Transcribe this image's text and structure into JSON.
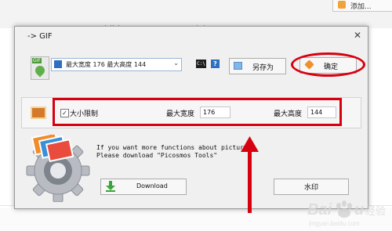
{
  "background": {
    "header_button_label": "添加...",
    "column1": "文件名",
    "column2": "大小"
  },
  "dialog": {
    "title": "-> GIF",
    "close_glyph": "✕",
    "preset_value": "最大宽度 176 最大高度 144",
    "preset_arrow": "⌄",
    "cmd_label": "C:\\",
    "help_label": "?",
    "save_as_label": "另存为",
    "ok_label": "确定",
    "size_limit_label": "大小限制",
    "size_limit_checked": true,
    "max_width_label": "最大宽度",
    "max_width_value": "176",
    "max_height_label": "最大高度",
    "max_height_value": "144",
    "info_line1": "If you want more functions about picture.",
    "info_line2": "Please download \"Picosmos Tools\"",
    "download_label": "Download",
    "watermark_label": "水印"
  },
  "annotation": {
    "highlight_color": "#d7000f"
  },
  "watermark_logo": {
    "text": "Baidu 经验"
  }
}
